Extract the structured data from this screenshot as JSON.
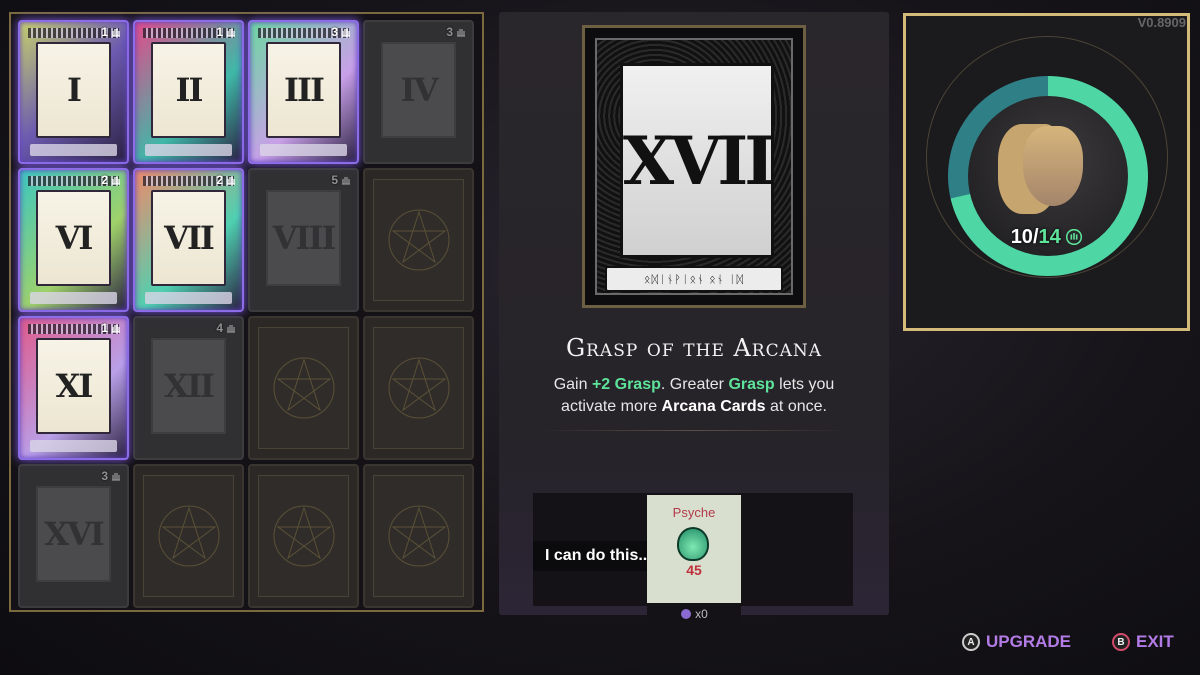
{
  "cards": [
    {
      "state": "active",
      "numeral": "I",
      "cost": "1",
      "tint": "gold"
    },
    {
      "state": "active",
      "numeral": "II",
      "cost": "1",
      "tint": "pink"
    },
    {
      "state": "active",
      "numeral": "III",
      "cost": "3",
      "tint": "green"
    },
    {
      "state": "locked",
      "numeral": "IV",
      "cost": "3"
    },
    {
      "state": "active",
      "numeral": "VI",
      "cost": "2",
      "tint": "teal"
    },
    {
      "state": "active",
      "numeral": "VII",
      "cost": "2",
      "tint": "salmon"
    },
    {
      "state": "locked",
      "numeral": "VIII",
      "cost": "5"
    },
    {
      "state": "empty"
    },
    {
      "state": "active",
      "numeral": "XI",
      "cost": "1",
      "tint": "rose"
    },
    {
      "state": "locked",
      "numeral": "XII",
      "cost": "4"
    },
    {
      "state": "empty"
    },
    {
      "state": "empty"
    },
    {
      "state": "locked",
      "numeral": "XVI",
      "cost": "3"
    },
    {
      "state": "empty"
    },
    {
      "state": "empty"
    },
    {
      "state": "empty"
    }
  ],
  "selected_card": {
    "numeral": "XVII",
    "runes": "ᛟᛞᛁᚾᚹᛁᛟᚾ ᛟᚾ ᛁᛞ",
    "title": "Grasp of the Arcana",
    "desc_parts": {
      "p1": "Gain ",
      "p2": "+2 Grasp",
      "p3": ". Greater ",
      "p4": "Grasp",
      "p5": " lets you activate more ",
      "p6": "Arcana Cards",
      "p7": " at once."
    }
  },
  "dialog": {
    "speech": "I can do this...",
    "resource_name": "Psyche",
    "resource_value": "45",
    "resource_count": "x0"
  },
  "portrait": {
    "grasp_current": "10",
    "grasp_sep": "/",
    "grasp_max": "14",
    "version": "V0.8909",
    "fill_fraction": 0.714
  },
  "prompts": {
    "upgrade_button": "A",
    "upgrade_label": "UPGRADE",
    "exit_button": "B",
    "exit_label": "EXIT"
  },
  "colors": {
    "accent_green": "#5ee39a",
    "accent_purple": "#b37be6",
    "frame_gold": "#d5bb7a"
  }
}
